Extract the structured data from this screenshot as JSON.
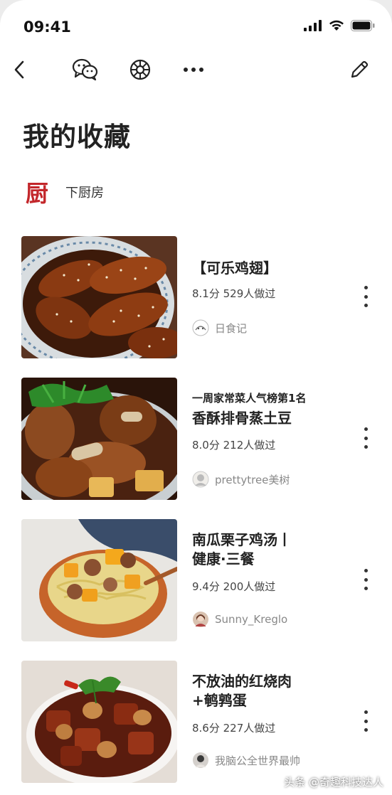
{
  "status": {
    "time": "09:41",
    "icons": [
      "signal-icon",
      "wifi-icon",
      "battery-icon"
    ]
  },
  "nav": {
    "icons": [
      "back-icon",
      "wechat-icon",
      "moments-icon",
      "more-icon",
      "edit-icon"
    ]
  },
  "page": {
    "title": "我的收藏"
  },
  "brand": {
    "logo_text": "厨",
    "name": "下厨房",
    "logo_color": "#c3272b"
  },
  "items": [
    {
      "subtitle": "",
      "title_lines": [
        "【可乐鸡翅】",
        ""
      ],
      "meta": "8.1分 529人做过",
      "author": "日食记"
    },
    {
      "subtitle": "一周家常菜人气榜第1名",
      "title_lines": [
        "香酥排骨蒸土豆",
        ""
      ],
      "meta": "8.0分 212人做过",
      "author": "prettytree美树"
    },
    {
      "subtitle": "",
      "title_lines": [
        "南瓜栗子鸡汤丨",
        "健康·三餐"
      ],
      "meta": "9.4分 200人做过",
      "author": "Sunny_Kreglo"
    },
    {
      "subtitle": "",
      "title_lines": [
        "不放油的红烧肉",
        "+鹌鹑蛋"
      ],
      "meta": "8.6分 227人做过",
      "author": "我脑公全世界最帅"
    }
  ],
  "watermark": "头条 @奇趣科技达人"
}
